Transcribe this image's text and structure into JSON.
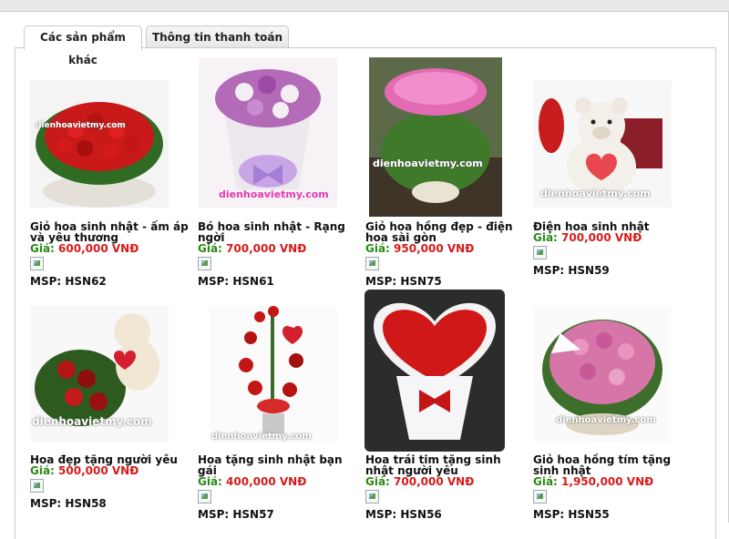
{
  "tabs": [
    {
      "label": "Các sản phẩm khác"
    },
    {
      "label": "Thông tin thanh toán"
    }
  ],
  "watermark": "dienhoavietmy.com",
  "colors": {
    "price_label": "#2b8a14",
    "price_value": "#d81a1a"
  },
  "products": [
    {
      "name": "Giỏ hoa sinh nhật - ấm áp và yêu thương",
      "price_label": "Giá:",
      "price": "600,000 VNĐ",
      "msp": "MSP: HSN62"
    },
    {
      "name": "Bó hoa sinh nhật - Rạng ngời",
      "price_label": "Giá:",
      "price": "700,000 VNĐ",
      "msp": "MSP: HSN61"
    },
    {
      "name": "Giỏ hoa hồng đẹp - điện hoa sài gòn",
      "price_label": "Giá:",
      "price": "950,000 VNĐ",
      "msp": "MSP: HSN75"
    },
    {
      "name": "Điện hoa sinh nhật",
      "price_label": "Giá:",
      "price": "700,000 VNĐ",
      "msp": "MSP: HSN59"
    },
    {
      "name": "Hoa đẹp tặng người yêu",
      "price_label": "Giá:",
      "price": "500,000 VNĐ",
      "msp": "MSP: HSN58"
    },
    {
      "name": "Hoa tặng sinh nhật bạn gái",
      "price_label": "Giá:",
      "price": "400,000 VNĐ",
      "msp": "MSP: HSN57"
    },
    {
      "name": "Hoa trái tim tặng sinh nhật người yêu",
      "price_label": "Giá:",
      "price": "700,000 VNĐ",
      "msp": "MSP: HSN56"
    },
    {
      "name": "Giỏ hoa hồng tím tặng sinh nhật",
      "price_label": "Giá:",
      "price": "1,950,000 VNĐ",
      "msp": "MSP: HSN55"
    }
  ]
}
